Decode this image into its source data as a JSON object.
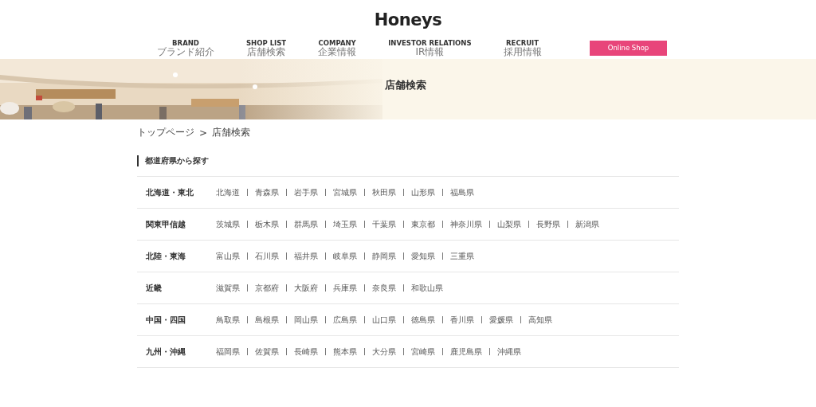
{
  "logo": "Honeys",
  "nav": [
    {
      "label": "BRAND",
      "sub": "ブランド紹介"
    },
    {
      "label": "SHOP LIST",
      "sub": "店舗検索"
    },
    {
      "label": "COMPANY",
      "sub": "企業情報"
    },
    {
      "label": "INVESTOR RELATIONS",
      "sub": "IR情報"
    },
    {
      "label": "RECRUIT",
      "sub": "採用情報"
    }
  ],
  "online_shop_button": "Online Shop",
  "hero": {
    "title": "店舗検索"
  },
  "breadcrumb": [
    "トップページ",
    "店舗検索"
  ],
  "breadcrumb_separator": ">",
  "section_title": "都道府県から探す",
  "regions": [
    {
      "name": "北海道・東北",
      "prefectures": [
        "北海道",
        "青森県",
        "岩手県",
        "宮城県",
        "秋田県",
        "山形県",
        "福島県"
      ]
    },
    {
      "name": "関東甲信越",
      "prefectures": [
        "茨城県",
        "栃木県",
        "群馬県",
        "埼玉県",
        "千葉県",
        "東京都",
        "神奈川県",
        "山梨県",
        "長野県",
        "新潟県"
      ]
    },
    {
      "name": "北陸・東海",
      "prefectures": [
        "富山県",
        "石川県",
        "福井県",
        "岐阜県",
        "静岡県",
        "愛知県",
        "三重県"
      ]
    },
    {
      "name": "近畿",
      "prefectures": [
        "滋賀県",
        "京都府",
        "大阪府",
        "兵庫県",
        "奈良県",
        "和歌山県"
      ]
    },
    {
      "name": "中国・四国",
      "prefectures": [
        "鳥取県",
        "島根県",
        "岡山県",
        "広島県",
        "山口県",
        "徳島県",
        "香川県",
        "愛媛県",
        "高知県"
      ]
    },
    {
      "name": "九州・沖縄",
      "prefectures": [
        "福岡県",
        "佐賀県",
        "長崎県",
        "熊本県",
        "大分県",
        "宮崎県",
        "鹿児島県",
        "沖縄県"
      ]
    }
  ]
}
